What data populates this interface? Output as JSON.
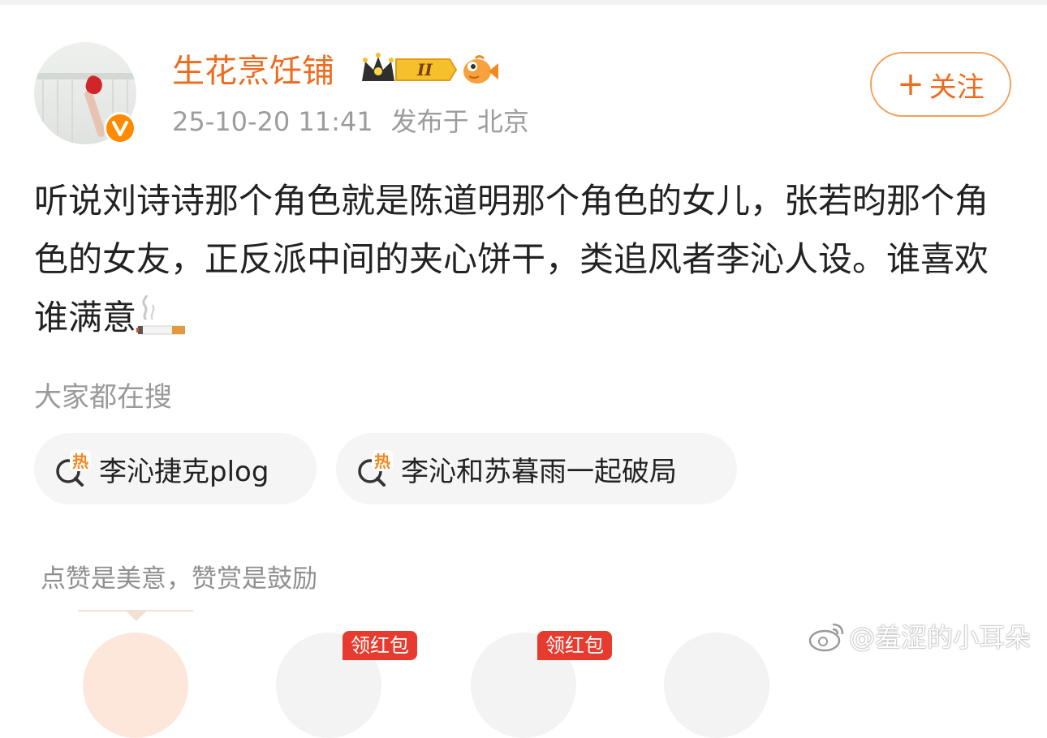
{
  "post": {
    "author": {
      "name": "生花烹饪铺",
      "level_badge": "II",
      "verified_mark": "V"
    },
    "timestamp": "25-10-20 11:41",
    "location": "发布于 北京",
    "follow_label": "关注",
    "body": "听说刘诗诗那个角色就是陈道明那个角色的女儿，张若昀那个角色的女友，正反派中间的夹心饼干，类追风者李沁人设。谁喜欢谁满意"
  },
  "search": {
    "title": "大家都在搜",
    "chips": [
      {
        "label": "李沁捷克plog",
        "icon": "hot-search-icon"
      },
      {
        "label": "李沁和苏暮雨一起破局",
        "icon": "hot-search-icon"
      }
    ]
  },
  "reward": {
    "text": "点赞是美意，赞赏是鼓励",
    "redpacket_label": "领红包"
  },
  "watermark": {
    "text": "@羞涩的小耳朵"
  },
  "colors": {
    "accent": "#ee6b1e",
    "follow_border": "#f4a05a",
    "muted": "#9c9c9c",
    "chip_bg": "#f5f5f5",
    "redpacket": "#e63b2e"
  }
}
